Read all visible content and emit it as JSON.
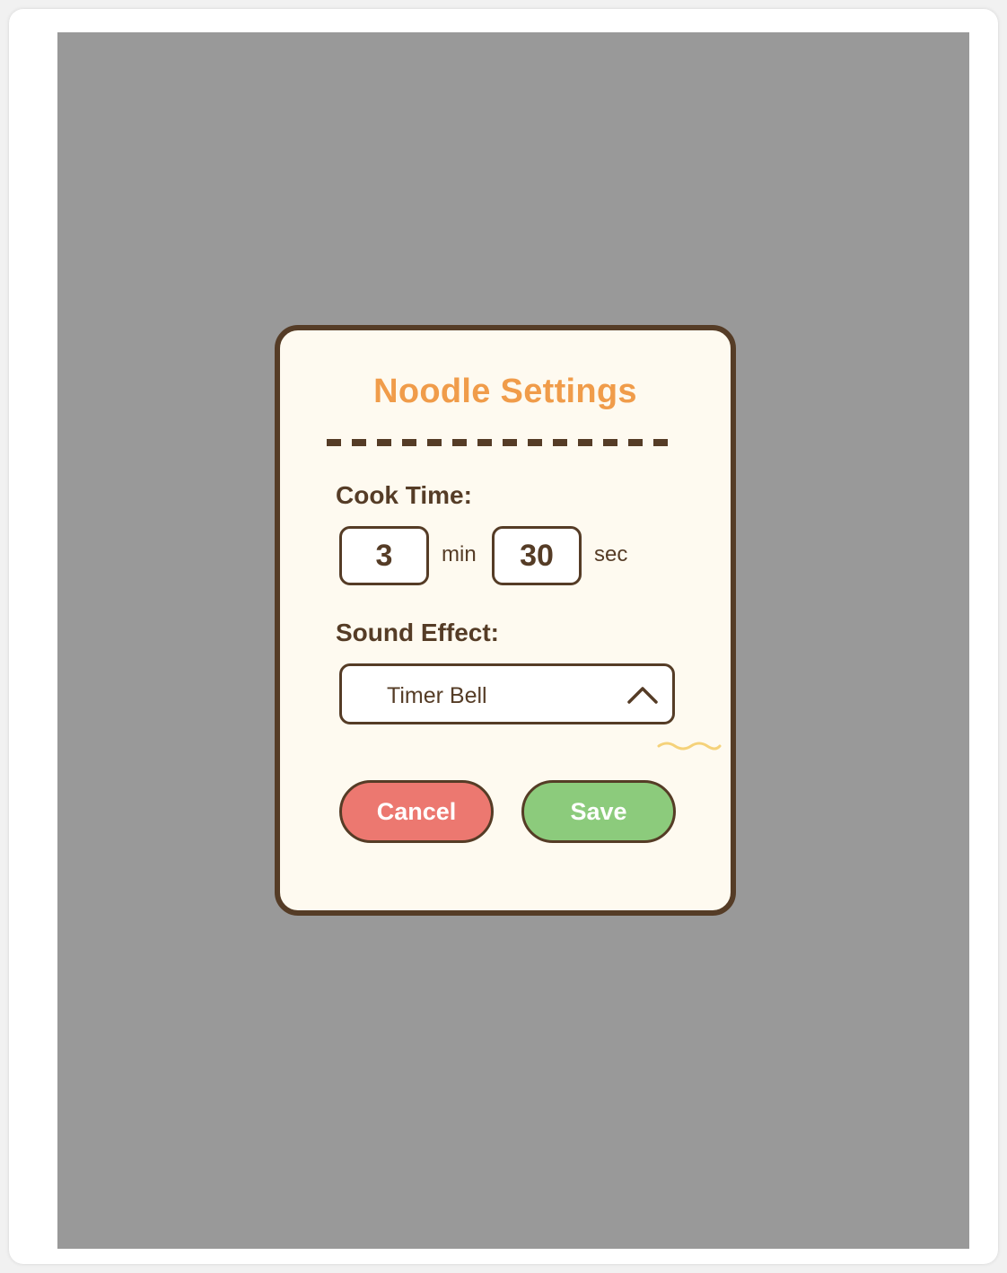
{
  "dialog": {
    "title": "Noodle Settings",
    "cook_time": {
      "label": "Cook Time:",
      "minutes": "3",
      "minutes_unit": "min",
      "seconds": "30",
      "seconds_unit": "sec"
    },
    "sound_effect": {
      "label": "Sound Effect:",
      "selected": "Timer Bell",
      "icon": "chevron-up-icon"
    },
    "buttons": {
      "cancel_label": "Cancel",
      "save_label": "Save"
    }
  },
  "colors": {
    "overlay": "#999999",
    "dialog_background": "#fefaf0",
    "border": "#553c26",
    "title": "#f09c4a",
    "cancel": "#ec7870",
    "save": "#8ccb7c",
    "squiggle": "#f5d27a"
  }
}
